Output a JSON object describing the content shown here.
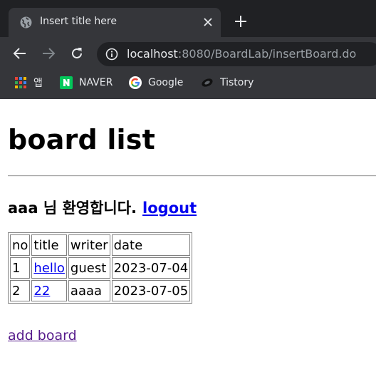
{
  "browser": {
    "tab_title": "Insert title here",
    "url_host": "localhost",
    "url_rest": ":8080/BoardLab/insertBoard.do",
    "bookmarks": [
      {
        "label": "앱",
        "icon": "apps-grid-icon"
      },
      {
        "label": "NAVER",
        "icon": "naver-icon"
      },
      {
        "label": "Google",
        "icon": "google-icon"
      },
      {
        "label": "Tistory",
        "icon": "tistory-icon"
      }
    ],
    "colors": {
      "tabstrip": "#202124",
      "toolbar": "#35363a",
      "omnibox": "#202124",
      "text": "#e8eaed"
    }
  },
  "page": {
    "title": "board list",
    "welcome_text": "aaa 님 환영합니다.",
    "logout_label": "logout",
    "table": {
      "headers": [
        "no",
        "title",
        "writer",
        "date"
      ],
      "rows": [
        {
          "no": "1",
          "title": "hello",
          "writer": "guest",
          "date": "2023-07-04"
        },
        {
          "no": "2",
          "title": "22",
          "writer": "aaaa",
          "date": "2023-07-05"
        }
      ]
    },
    "add_board_label": "add board",
    "colors": {
      "link": "#0000ee",
      "visited_link": "#551a8b"
    }
  }
}
